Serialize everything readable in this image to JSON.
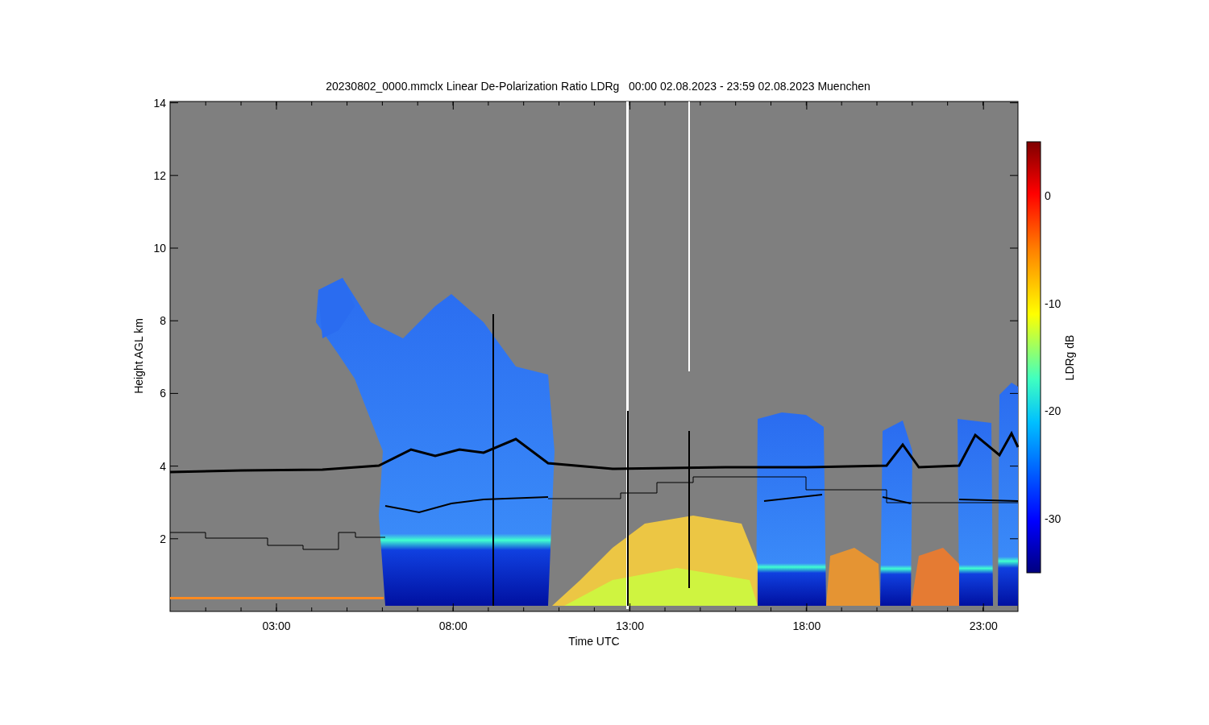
{
  "title": "20230802_0000.mmclx Linear De-Polarization Ratio LDRg   00:00 02.08.2023 - 23:59 02.08.2023 Muenchen",
  "y_axis": {
    "label": "Height AGL km",
    "ticks": [
      "14",
      "12",
      "10",
      "8",
      "6",
      "4",
      "2"
    ]
  },
  "x_axis": {
    "label": "Time UTC",
    "ticks": [
      "03:00",
      "08:00",
      "13:00",
      "18:00",
      "23:00"
    ]
  },
  "colorbar": {
    "label": "LDRg dB",
    "ticks": [
      "0",
      "-10",
      "-20",
      "-30"
    ]
  }
}
